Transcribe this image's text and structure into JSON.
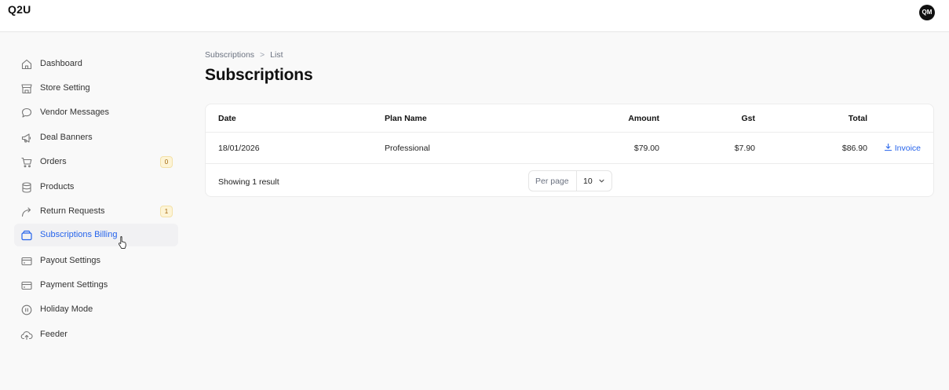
{
  "app": {
    "brand": "Q2U",
    "user_initials": "QM"
  },
  "sidebar": {
    "items": [
      {
        "label": "Dashboard",
        "icon": "home-icon"
      },
      {
        "label": "Store Setting",
        "icon": "store-icon"
      },
      {
        "label": "Vendor Messages",
        "icon": "message-icon"
      },
      {
        "label": "Deal Banners",
        "icon": "megaphone-icon"
      },
      {
        "label": "Orders",
        "icon": "cart-icon",
        "badge": "0"
      },
      {
        "label": "Products",
        "icon": "database-icon"
      },
      {
        "label": "Return Requests",
        "icon": "return-arrow-icon",
        "badge": "1"
      },
      {
        "label": "Subscriptions Billing",
        "icon": "wallet-icon",
        "active": true
      },
      {
        "label": "Payout Settings",
        "icon": "card-icon"
      },
      {
        "label": "Payment Settings",
        "icon": "card-icon"
      },
      {
        "label": "Holiday Mode",
        "icon": "pause-circle-icon"
      },
      {
        "label": "Feeder",
        "icon": "cloud-upload-icon"
      }
    ]
  },
  "breadcrumb": {
    "parent": "Subscriptions",
    "separator": ">",
    "current": "List"
  },
  "page": {
    "title": "Subscriptions"
  },
  "table": {
    "headers": {
      "date": "Date",
      "plan": "Plan Name",
      "amount": "Amount",
      "gst": "Gst",
      "total": "Total"
    },
    "rows": [
      {
        "date": "18/01/2026",
        "plan": "Professional",
        "amount": "$79.00",
        "gst": "$7.90",
        "total": "$86.90",
        "action": "Invoice"
      }
    ]
  },
  "footer": {
    "showing": "Showing 1 result",
    "per_page_label": "Per page",
    "per_page_value": "10"
  },
  "colors": {
    "accent": "#2563eb",
    "badge_bg": "#fdf4d6",
    "badge_text": "#a16207"
  }
}
